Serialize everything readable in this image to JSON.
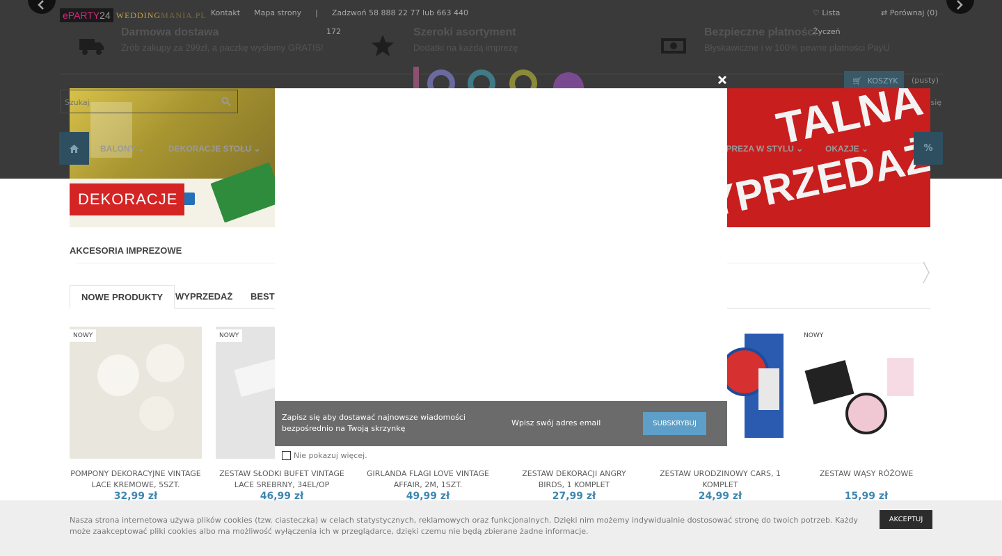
{
  "header": {
    "logo_main": "ePARTY",
    "logo_num": "24",
    "logo_second": "WEDDING",
    "logo_second_tail": "MANIA.PL",
    "links": [
      "Kontakt",
      "Mapa strony",
      "|",
      "Zadzwoń 58 888 22 77 lub 663 440"
    ],
    "phone_tail": "172",
    "wishlist": "Lista",
    "wishlist_tail": "Życzeń",
    "compare": "Porównaj (0)",
    "cart_label": "KOSZYK",
    "cart_status": "(pusty)",
    "register": "Zarejestruj się",
    "search_placeholder": "Szukaj"
  },
  "features": [
    {
      "title": "Darmowa dostawa",
      "text": "Zrób zakupy za 299zł, a paczkę wyślemy GRATIS!",
      "icon": "truck-icon"
    },
    {
      "title": "Szeroki asortyment",
      "text": "Dodatki na każdą imprezę",
      "icon": "star-icon"
    },
    {
      "title": "Bezpieczne płatności",
      "text": "Błyskawiczne i w 100% pewne płatności PayU",
      "icon": "money-icon"
    }
  ],
  "menu": {
    "items": [
      "BALONY",
      "DEKORACJE STOŁU",
      "IMPREZA W STYLU",
      "OKAZJE"
    ],
    "percent": "%"
  },
  "banners": {
    "left_label": "DEKORACJE",
    "right_line1": "TALNA",
    "right_line2": "YPRZEDAŻ!"
  },
  "section_title": "AKCESORIA IMPREZOWE",
  "tabs": [
    "NOWE PRODUKTY",
    "WYPRZEDAŻ",
    "BESTS"
  ],
  "products": [
    {
      "badge": "NOWY",
      "name": "POMPONY DEKORACYJNE VINTAGE LACE KREMOWE, 5SZT.",
      "price": "32,99 zł"
    },
    {
      "badge": "NOWY",
      "name": "ZESTAW SŁODKI BUFET VINTAGE LACE SREBRNY, 34EL/OP",
      "price": "46,99 zł"
    },
    {
      "badge": "",
      "name": "GIRLANDA FLAGI LOVE VINTAGE AFFAIR, 2M, 1SZT.",
      "price": "49,99 zł"
    },
    {
      "badge": "",
      "name": "ZESTAW DEKORACJI ANGRY BIRDS, 1 KOMPLET",
      "price": "27,99 zł"
    },
    {
      "badge": "",
      "name": "ZESTAW URODZINOWY CARS, 1 KOMPLET",
      "price": "24,99 zł"
    },
    {
      "badge": "NOWY",
      "name": "ZESTAW WĄSY RÓŻOWE",
      "price": "15,99 zł"
    }
  ],
  "modal": {
    "subscribe_text": "Zapisz się aby dostawać najnowsze wiadomości bezpośrednio na Twoją skrzynkę",
    "email_placeholder": "Wpisz swój adres email",
    "subscribe_button": "SUBSKRYBUJ",
    "dont_show": "Nie pokazuj więcej."
  },
  "cookie": {
    "text": "Nasza strona internetowa używa plików cookies (tzw. ciasteczka) w celach statystycznych, reklamowych oraz funkcjonalnych. Dzięki nim możemy indywidualnie dostosować stronę do twoich potrzeb. Każdy może zaakceptować pliki cookies albo ma możliwość wyłączenia ich w przeglądarce, dzięki czemu nie będą zbierane żadne informacje.",
    "accept": "AKCEPTUJ"
  },
  "colors": {
    "accent_blue": "#3d86b0",
    "menu_dark_blue": "#2d4f60",
    "subscribe_button": "#5d9fc8",
    "sale_red": "#c81e1e",
    "logo_pink": "#d62a7e"
  }
}
